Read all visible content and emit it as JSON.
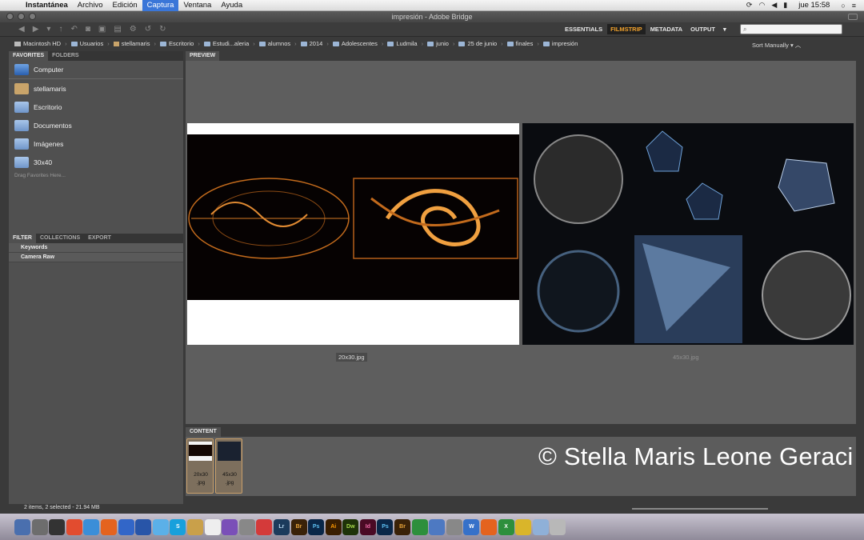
{
  "menubar": {
    "app_name": "Instantánea",
    "items": [
      "Archivo",
      "Edición",
      "Captura",
      "Ventana",
      "Ayuda"
    ],
    "clock": "jue 15:58"
  },
  "window": {
    "title": "impresión - Adobe Bridge"
  },
  "workspaces": [
    "ESSENTIALS",
    "FILMSTRIP",
    "METADATA",
    "OUTPUT"
  ],
  "path": [
    "Macintosh HD",
    "Usuarios",
    "stellamaris",
    "Escritorio",
    "Estudi...aleria",
    "alumnos",
    "2014",
    "Adolescentes",
    "Ludmila",
    "junio",
    "25 de junio",
    "finales",
    "impresión"
  ],
  "sort": "Sort Manually",
  "left_panel": {
    "tabs": [
      "FAVORITES",
      "FOLDERS"
    ],
    "favorites": [
      "Computer",
      "stellamaris",
      "Escritorio",
      "Documentos",
      "Imágenes",
      "30x40"
    ],
    "hint": "Drag Favorites Here...",
    "filter_tabs": [
      "FILTER",
      "COLLECTIONS",
      "EXPORT"
    ],
    "filters": [
      "Keywords",
      "Camera Raw"
    ]
  },
  "preview": {
    "tab": "PREVIEW",
    "captions": [
      "20x30.jpg",
      "45x30.jpg"
    ]
  },
  "content": {
    "tab": "CONTENT",
    "items": [
      {
        "name": "20x30",
        "ext": ".jpg"
      },
      {
        "name": "45x30",
        "ext": ".jpg"
      }
    ]
  },
  "status": "2 items, 2 selected - 21.94 MB",
  "watermark": "© Stella Maris Leone Geraci",
  "dock": [
    "Lr",
    "Br",
    "Ps",
    "Ai",
    "Dw",
    "Id",
    "Ps",
    "Br"
  ]
}
